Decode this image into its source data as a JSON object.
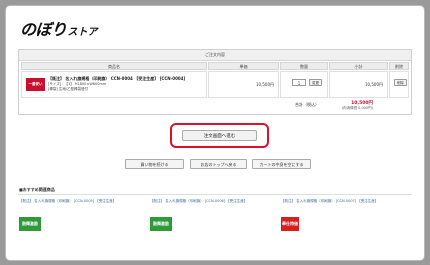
{
  "header": {
    "logo_main": "のぼり",
    "logo_sub": "ストア"
  },
  "order": {
    "panel_title": "ご注文内容",
    "columns": [
      "商品名",
      "単価",
      "数量",
      "小計",
      "削除"
    ],
    "item": {
      "thumb_text": "一番安い",
      "name": "【既注】 名入れ旗規格（印刷旗） CCN-0004 【受注生産】 [CCN-0004]",
      "size": "[サイズ] : 【1】 H1800×W600mm",
      "process": "[棒袋] 生地/乙型棒袋縫付",
      "unit_price": "10,500円",
      "qty": "1",
      "qty_button": "変更",
      "subtotal": "10,500円",
      "delete_button": "削除"
    },
    "total_label": "合計（税込）",
    "total_value": "10,500円",
    "total_note": "(内消費税 0,000円)"
  },
  "actions": {
    "order_button": "注文画面へ進む",
    "continue_button": "買い物を続ける",
    "store_top_button": "お店のトップへ戻る",
    "clear_cart_button": "カートの中身を空にする"
  },
  "recommend": {
    "title": "■おすすめ関連商品",
    "items": [
      {
        "label": "【既注】 名入れ旗規格（印刷旗） [CCN-0005] 【受注生産】",
        "img_text": "鼓舞激励",
        "img_color": "#2e9a3a"
      },
      {
        "label": "【既注】 名入れ旗規格（印刷旗） [CCN-0006] 【受注生産】",
        "img_text": "鼓舞激励",
        "img_color": "#2e9a3a"
      },
      {
        "label": "【既注】 名入れ旗規格（印刷旗） [CCN-0007] 【受注生産】",
        "img_text": "奉仕特価",
        "img_color": "#d81e1e"
      }
    ]
  }
}
